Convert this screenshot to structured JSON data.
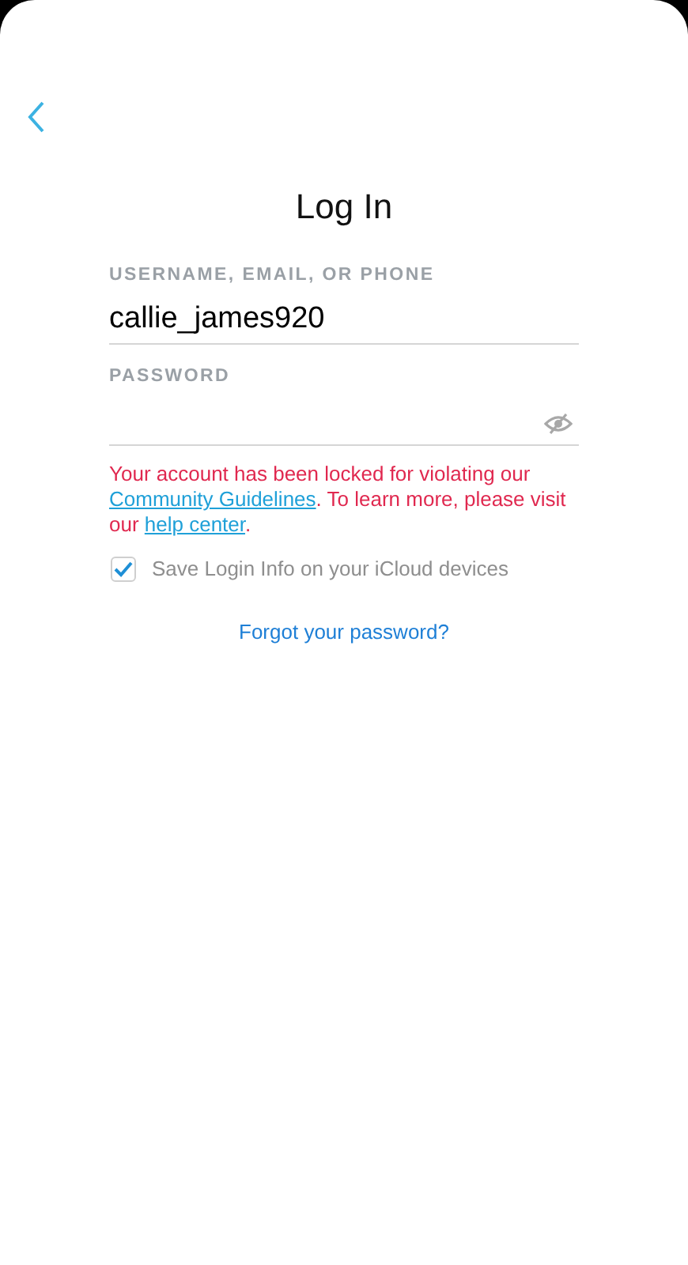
{
  "title": "Log In",
  "username_field": {
    "label": "USERNAME, EMAIL, OR PHONE",
    "value": "callie_james920"
  },
  "password_field": {
    "label": "PASSWORD"
  },
  "error_message": [
    {
      "kind": "text",
      "text": "Your account has been locked for violating our "
    },
    {
      "kind": "link",
      "text": "Community Guidelines"
    },
    {
      "kind": "text",
      "text": ". To learn more, please visit our "
    },
    {
      "kind": "link",
      "text": "help center"
    },
    {
      "kind": "text",
      "text": "."
    }
  ],
  "save_login": {
    "label": "Save Login Info on your iCloud devices",
    "checked": true
  },
  "forgot_link": "Forgot your password?"
}
